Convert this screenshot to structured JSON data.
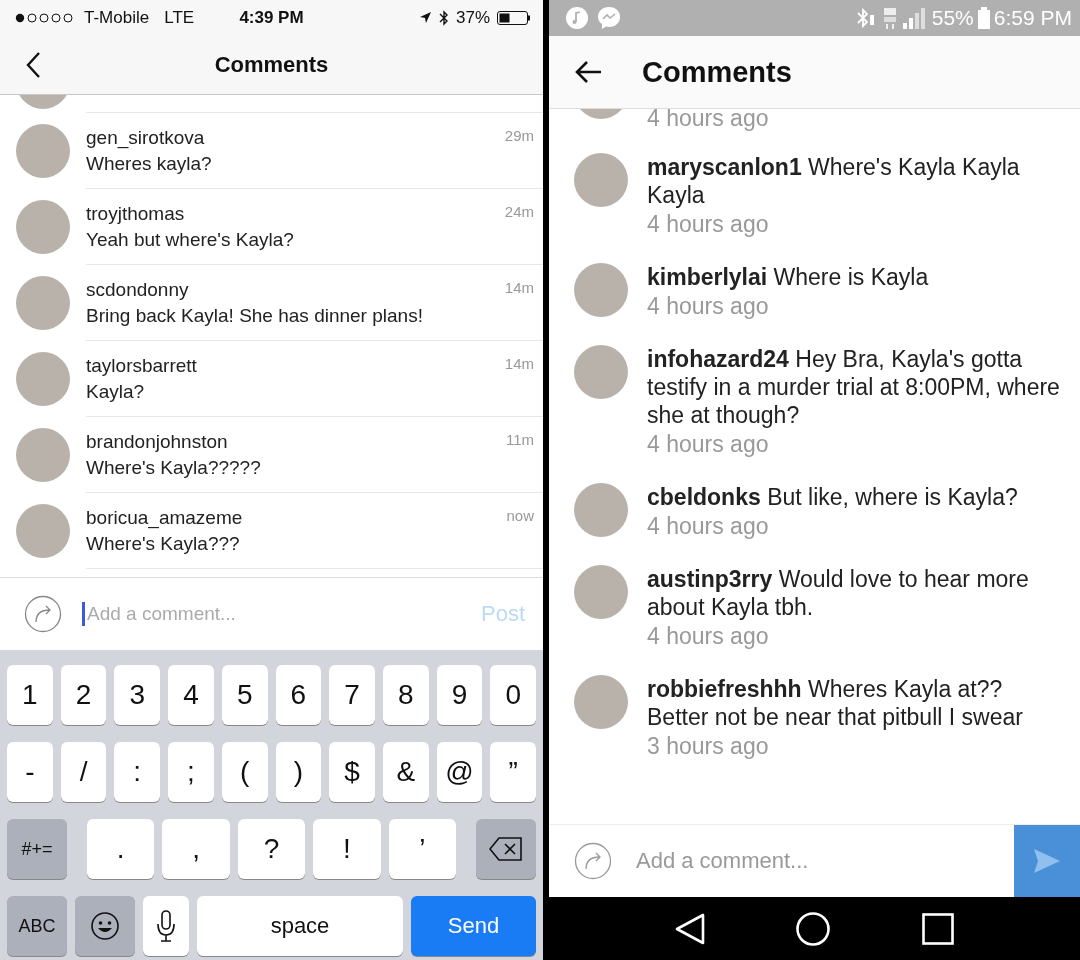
{
  "ios": {
    "status": {
      "carrier": "T-Mobile",
      "network": "LTE",
      "time": "4:39 PM",
      "battery": "37%"
    },
    "header": {
      "title": "Comments"
    },
    "comments": [
      {
        "username": "gen_sirotkova",
        "text": "Wheres kayla?",
        "time": "29m"
      },
      {
        "username": "troyjthomas",
        "text": "Yeah but where's Kayla?",
        "time": "24m"
      },
      {
        "username": "scdondonny",
        "text": "Bring back Kayla! She has dinner plans!",
        "time": "14m"
      },
      {
        "username": "taylorsbarrett",
        "text": "Kayla?",
        "time": "14m"
      },
      {
        "username": "brandonjohnston",
        "text": "Where's Kayla?????",
        "time": "11m"
      },
      {
        "username": "boricua_amazeme",
        "text": "Where's Kayla???",
        "time": "now"
      }
    ],
    "composer": {
      "placeholder": "Add a comment...",
      "post": {
        "label": "Post",
        "disabled": true
      }
    },
    "keyboard": {
      "number_keys": [
        {
          "kind": "char",
          "label": "1"
        },
        {
          "kind": "char",
          "label": "2"
        },
        {
          "kind": "char",
          "label": "3"
        },
        {
          "kind": "char",
          "label": "4"
        },
        {
          "kind": "char",
          "label": "5"
        },
        {
          "kind": "char",
          "label": "6"
        },
        {
          "kind": "char",
          "label": "7"
        },
        {
          "kind": "char",
          "label": "8"
        },
        {
          "kind": "char",
          "label": "9"
        },
        {
          "kind": "char",
          "label": "0"
        }
      ],
      "symbol_keys": [
        {
          "kind": "char",
          "label": "-"
        },
        {
          "kind": "char",
          "label": "/"
        },
        {
          "kind": "char",
          "label": ":"
        },
        {
          "kind": "char",
          "label": ";"
        },
        {
          "kind": "char",
          "label": "("
        },
        {
          "kind": "char",
          "label": ")"
        },
        {
          "kind": "char",
          "label": "$"
        },
        {
          "kind": "char",
          "label": "&"
        },
        {
          "kind": "char",
          "label": "@"
        },
        {
          "kind": "char",
          "label": "”"
        }
      ],
      "punctuation_keys": [
        {
          "kind": "action",
          "label": "#+="
        },
        {
          "kind": "char",
          "label": "."
        },
        {
          "kind": "char",
          "label": ","
        },
        {
          "kind": "char",
          "label": "?"
        },
        {
          "kind": "char",
          "label": "!"
        },
        {
          "kind": "char",
          "label": "’"
        },
        {
          "kind": "backspace"
        }
      ],
      "bottom_keys": [
        {
          "kind": "action",
          "label": "ABC"
        },
        {
          "kind": "emoji"
        },
        {
          "kind": "mic"
        },
        {
          "kind": "space",
          "label": "space"
        },
        {
          "kind": "send",
          "label": "Send"
        }
      ]
    }
  },
  "android": {
    "status": {
      "battery": "55%",
      "time": "6:59 PM"
    },
    "header": {
      "title": "Comments"
    },
    "top_partial": {
      "time": "4 hours ago"
    },
    "comments": [
      {
        "username": "maryscanlon1",
        "text": "Where's Kayla Kayla Kayla",
        "time": "4 hours ago"
      },
      {
        "username": "kimberlylai",
        "text": "Where is Kayla",
        "time": "4 hours ago"
      },
      {
        "username": "infohazard24",
        "text": "Hey Bra, Kayla's gotta testify in a murder trial at 8:00PM, where she at though?",
        "time": "4 hours ago"
      },
      {
        "username": "cbeldonks",
        "text": "But like, where is Kayla?",
        "time": "4 hours ago"
      },
      {
        "username": "austinp3rry",
        "text": "Would love to hear more about Kayla tbh.",
        "time": "4 hours ago"
      },
      {
        "username": "robbiefreshhh",
        "text": "Wheres Kayla at?? Better not be near that pitbull I swear",
        "time": "3 hours ago"
      }
    ],
    "composer": {
      "placeholder": "Add a comment..."
    }
  }
}
